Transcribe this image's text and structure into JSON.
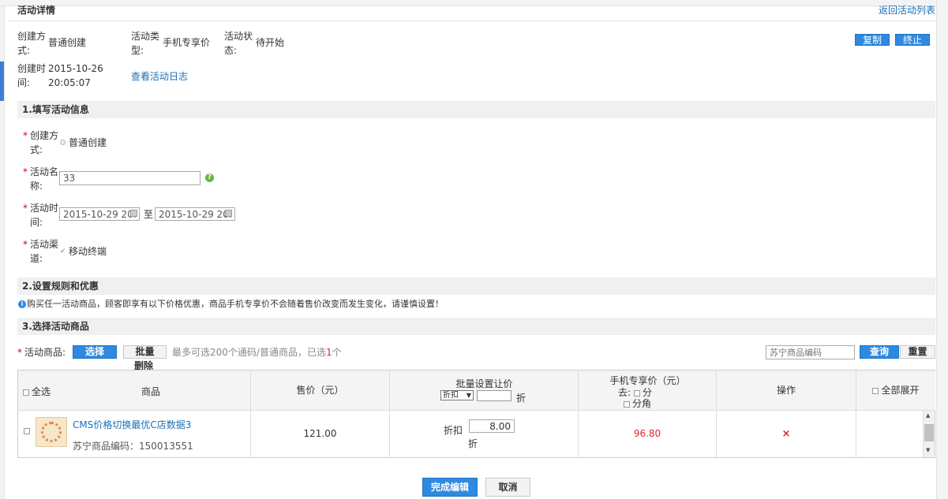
{
  "header": {
    "title": "活动详情",
    "back_link": "返回活动列表"
  },
  "summary": {
    "create_method_label": "创建方式:",
    "create_method_value": "普通创建",
    "type_label": "活动类型:",
    "type_value": "手机专享价",
    "status_label": "活动状态:",
    "status_value": "待开始",
    "created_time_label": "创建时间:",
    "created_date": "2015-10-26",
    "created_time": "20:05:07",
    "log_link": "查看活动日志",
    "copy_button": "复制",
    "stop_button": "终止"
  },
  "section1": {
    "title": "1.填写活动信息",
    "method_label": "创建方式:",
    "method_value": "普通创建",
    "name_label": "活动名称:",
    "name_value": "33",
    "time_label": "活动时间:",
    "time_start": "2015-10-29 20:",
    "time_sep": "至",
    "time_end": "2015-10-29 20:",
    "channel_label": "活动渠道:",
    "channel_value": "移动终端"
  },
  "section2": {
    "title": "2.设置规则和优惠",
    "notice": "购买任一活动商品，顾客即享有以下价格优惠，商品手机专享价不会随着售价改变而发生变化，请谨慎设置！"
  },
  "section3": {
    "title": "3.选择活动商品",
    "goods_label": "活动商品:",
    "select_button": "选择",
    "batch_delete_button_1": "批量",
    "batch_delete_button_2": "删除",
    "limit_text_prefix": "最多可选200个通码/普通商品，已选",
    "selected_count": "1",
    "limit_text_suffix": "个",
    "search_placeholder": "苏宁商品编码",
    "query_button": "查询",
    "reset_button": "重置"
  },
  "table": {
    "select_all": "全选",
    "col_product": "商品",
    "col_price": "售价（元）",
    "col_batch": "批量设置让价",
    "batch_select": "折扣",
    "batch_unit": "折",
    "col_mobile": "手机专享价（元）",
    "mobile_remove": "去:",
    "mobile_fen": "分",
    "mobile_fenjiao": "分角",
    "col_action": "操作",
    "expand_all": "全部展开",
    "rows": [
      {
        "name": "CMS价格切换最优C店数据3",
        "code_label": "苏宁商品编码：",
        "code": "150013551",
        "price": "121.00",
        "discount_label": "折扣",
        "discount_value": "8.00",
        "discount_unit": "折",
        "mobile_price": "96.80",
        "delete_icon": "×"
      }
    ]
  },
  "footer": {
    "finish_button": "完成编辑",
    "cancel_button": "取消"
  }
}
